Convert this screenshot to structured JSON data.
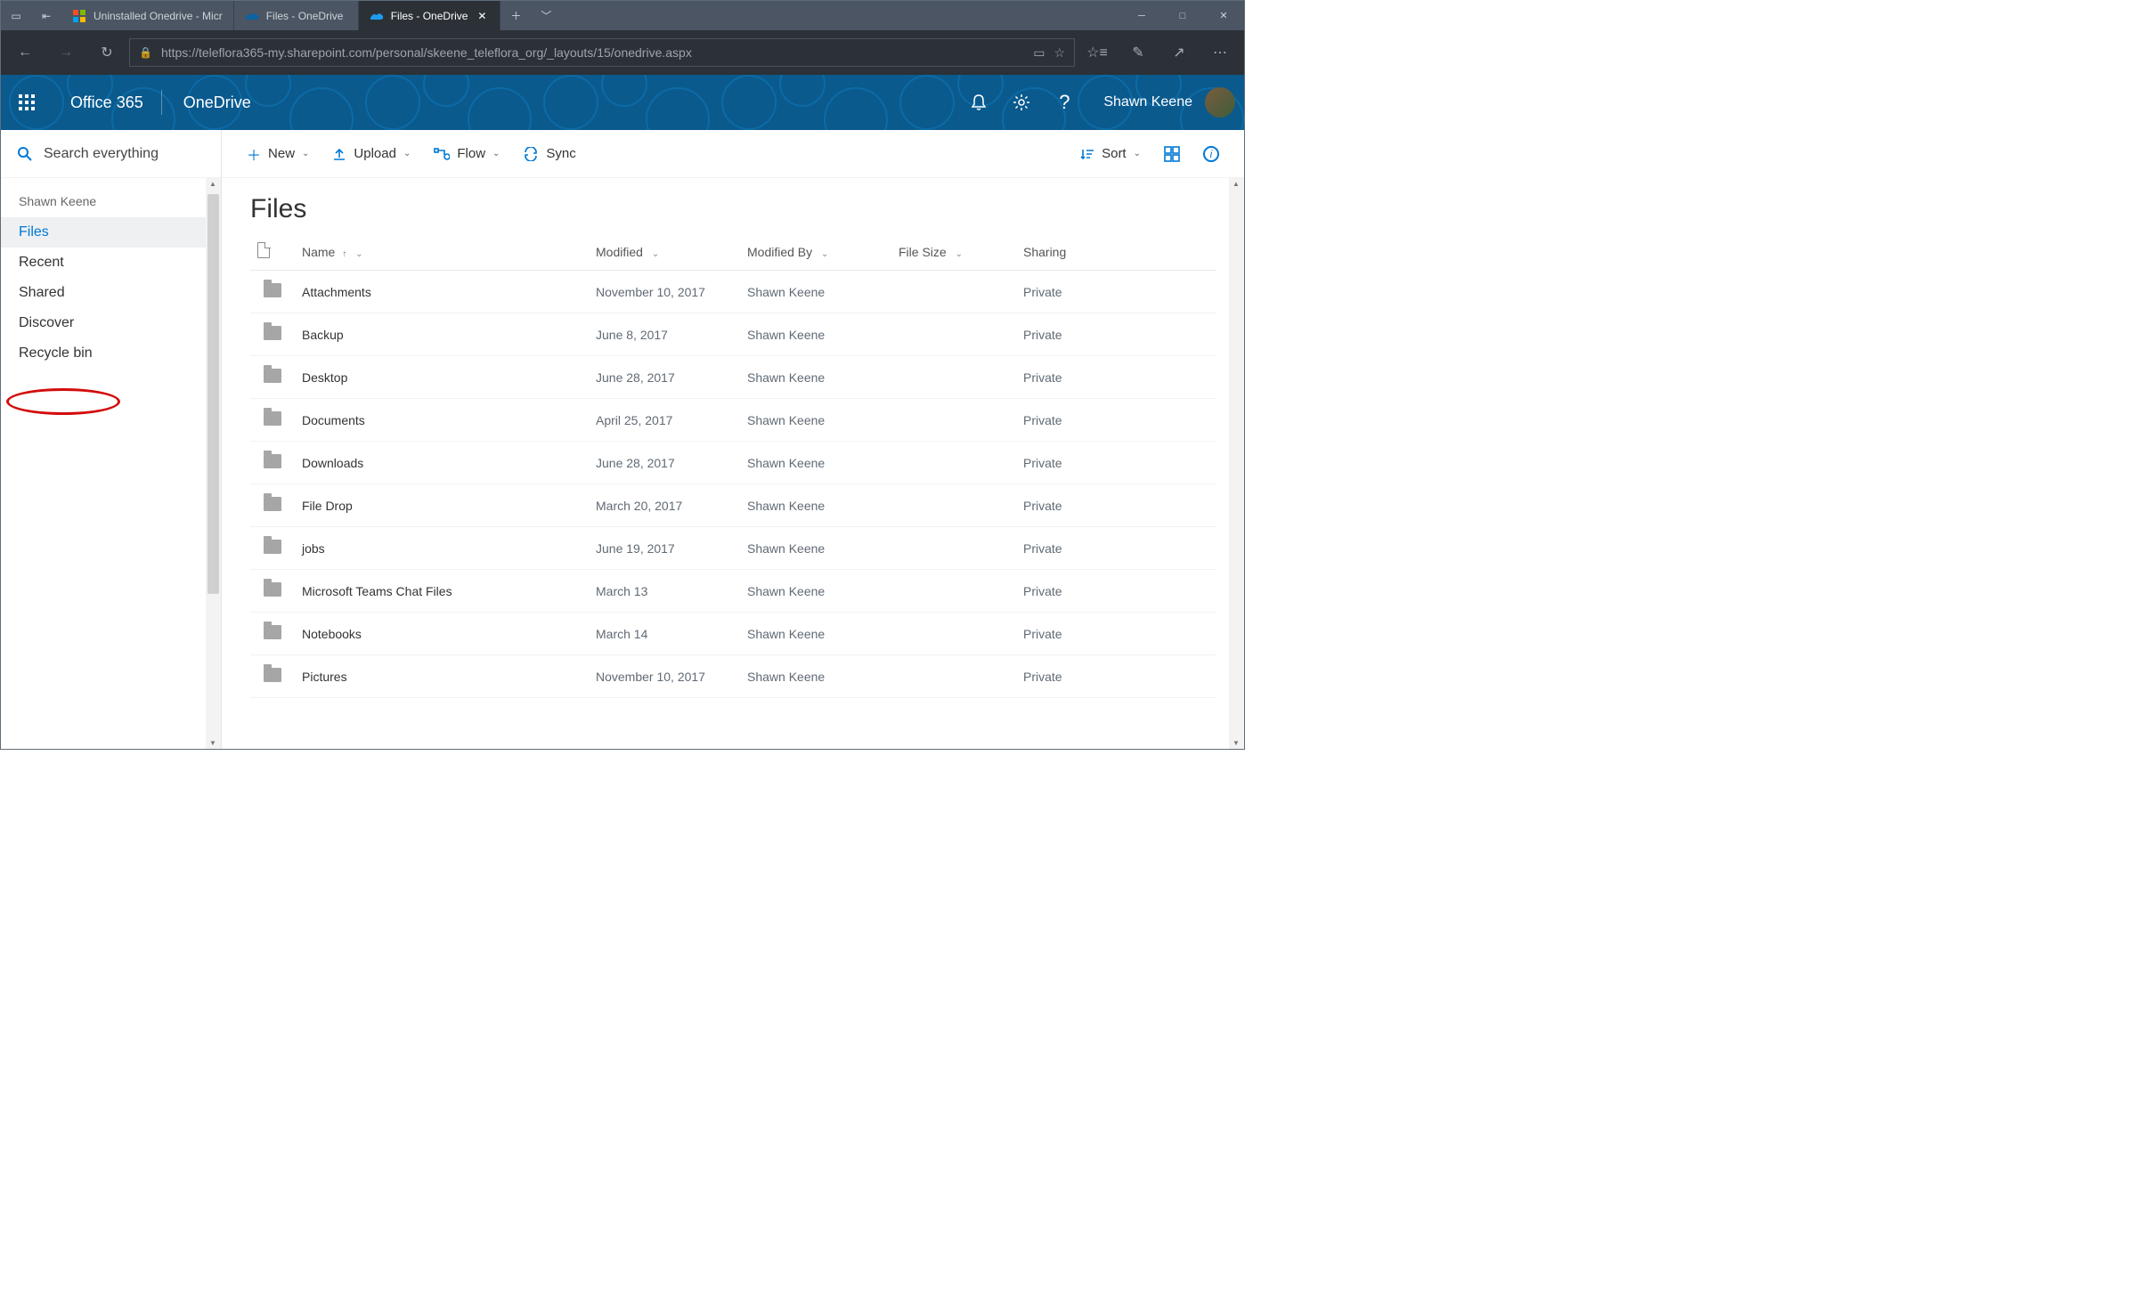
{
  "browser": {
    "tabs": [
      {
        "title": "Uninstalled Onedrive - Micr",
        "icon": "edge-colored"
      },
      {
        "title": "Files - OneDrive",
        "icon": "onedrive"
      },
      {
        "title": "Files - OneDrive",
        "icon": "onedrive",
        "active": true
      }
    ],
    "url": "https://teleflora365-my.sharepoint.com/personal/skeene_teleflora_org/_layouts/15/onedrive.aspx"
  },
  "suite": {
    "brand": "Office 365",
    "app": "OneDrive",
    "user": "Shawn Keene"
  },
  "search_placeholder": "Search everything",
  "nav": {
    "owner": "Shawn Keene",
    "items": [
      {
        "label": "Files",
        "active": true
      },
      {
        "label": "Recent"
      },
      {
        "label": "Shared"
      },
      {
        "label": "Discover"
      },
      {
        "label": "Recycle bin",
        "annot": true
      }
    ]
  },
  "commands": {
    "new": "New",
    "upload": "Upload",
    "flow": "Flow",
    "sync": "Sync",
    "sort": "Sort"
  },
  "page_title": "Files",
  "columns": {
    "name": "Name",
    "modified": "Modified",
    "modifiedBy": "Modified By",
    "fileSize": "File Size",
    "sharing": "Sharing"
  },
  "rows": [
    {
      "name": "Attachments",
      "modified": "November 10, 2017",
      "modifiedBy": "Shawn Keene",
      "sharing": "Private"
    },
    {
      "name": "Backup",
      "modified": "June 8, 2017",
      "modifiedBy": "Shawn Keene",
      "sharing": "Private"
    },
    {
      "name": "Desktop",
      "modified": "June 28, 2017",
      "modifiedBy": "Shawn Keene",
      "sharing": "Private"
    },
    {
      "name": "Documents",
      "modified": "April 25, 2017",
      "modifiedBy": "Shawn Keene",
      "sharing": "Private"
    },
    {
      "name": "Downloads",
      "modified": "June 28, 2017",
      "modifiedBy": "Shawn Keene",
      "sharing": "Private"
    },
    {
      "name": "File Drop",
      "modified": "March 20, 2017",
      "modifiedBy": "Shawn Keene",
      "sharing": "Private"
    },
    {
      "name": "jobs",
      "modified": "June 19, 2017",
      "modifiedBy": "Shawn Keene",
      "sharing": "Private"
    },
    {
      "name": "Microsoft Teams Chat Files",
      "modified": "March 13",
      "modifiedBy": "Shawn Keene",
      "sharing": "Private"
    },
    {
      "name": "Notebooks",
      "modified": "March 14",
      "modifiedBy": "Shawn Keene",
      "sharing": "Private"
    },
    {
      "name": "Pictures",
      "modified": "November 10, 2017",
      "modifiedBy": "Shawn Keene",
      "sharing": "Private"
    }
  ]
}
